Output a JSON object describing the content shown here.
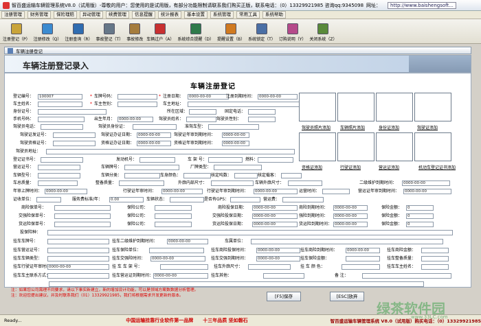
{
  "window": {
    "title": "智百盛运输车辆管理系统V8.0（试用版）-尊敬的用户：您使用的是试用版，有部分功能限制请联系我们购买正版，联系电话：（0）13329921985  咨询qq:9345098",
    "url_label": "网址：",
    "url": "http://www.baishengsoft..."
  },
  "menu": [
    "注册管理",
    "财务管理",
    "保险理赔",
    "异动管理",
    "续费管理",
    "信息提醒",
    "统计报表",
    "基本设置",
    "系统管理",
    "常用工具",
    "系统帮助"
  ],
  "toolbar": [
    {
      "label": "注册登记（P）",
      "icon": "register-icon",
      "color": "#c9a43a"
    },
    {
      "label": "注册修改（Q）",
      "icon": "edit-register-icon",
      "color": "#3b8bd0"
    },
    {
      "label": "注册查询（R）",
      "icon": "query-icon",
      "color": "#2f6cb0"
    },
    {
      "label": "事故登记（T）",
      "icon": "accident-icon",
      "color": "#667788"
    },
    {
      "label": "事故修改",
      "icon": "accident-edit-icon",
      "color": "#a57c3c"
    },
    {
      "label": "车辆过户（A）",
      "icon": "transfer-icon",
      "color": "#c83030"
    },
    {
      "label": "系统综合提醒（D）",
      "icon": "reminder-icon",
      "color": "#2f7a4a"
    },
    {
      "label": "提醒设置（B）",
      "icon": "reminder-settings-icon",
      "color": "#d07a20"
    },
    {
      "label": "系统锁定（T）",
      "icon": "lock-icon",
      "color": "#4a6fa5"
    },
    {
      "label": "订购说明（Y）",
      "icon": "order-icon",
      "color": "#b54a8a"
    },
    {
      "label": "关闭系统（Z）",
      "icon": "close-system-icon",
      "color": "#5a8a3a"
    }
  ],
  "inner_window_title": "车辆注册登记",
  "banner_title": "车辆注册登记录入",
  "form_title": "车辆注册登记",
  "fields": [
    {
      "label": "登记编号：",
      "value": "100007"
    },
    {
      "label": "车牌号码：",
      "value": ""
    },
    {
      "label": "注册日期：",
      "value": "0000-00-00"
    },
    {
      "label": "注册到期时间：",
      "value": "0000-00-00"
    },
    {
      "label": "车主姓名：",
      "value": ""
    },
    {
      "label": "车主性别：",
      "value": ""
    },
    {
      "label": "车主地址：",
      "value": ""
    },
    {
      "label": "身份证号：",
      "value": ""
    },
    {
      "label": "所在区域：",
      "value": ""
    },
    {
      "label": "固定电话：",
      "value": ""
    },
    {
      "label": "手机号码：",
      "value": ""
    },
    {
      "label": "出生年月：",
      "value": "0000-00-00"
    },
    {
      "label": "驾驶员姓名：",
      "value": ""
    },
    {
      "label": "驾驶员性别：",
      "value": ""
    },
    {
      "label": "驾驶员电话：",
      "value": ""
    },
    {
      "label": "驾驶员身份证：",
      "value": ""
    },
    {
      "label": "准驾车型：",
      "value": ""
    },
    {
      "label": "驾驶证发证号：",
      "value": ""
    },
    {
      "label": "驾驶证办证日期：",
      "value": "0000-00-00"
    },
    {
      "label": "驾驶证年审到期时间：",
      "value": "0000-00-00"
    },
    {
      "label": "驾驶资格证号：",
      "value": ""
    },
    {
      "label": "资格证办证日期：",
      "value": "0000-00-00"
    },
    {
      "label": "资格证年审到期时间：",
      "value": "0000-00-00"
    },
    {
      "label": "驾驶员地址：",
      "value": ""
    },
    {
      "label": "登记证书号：",
      "value": ""
    },
    {
      "label": "发动机号：",
      "value": ""
    },
    {
      "label": "车  架  号：",
      "value": ""
    },
    {
      "label": "燃料：",
      "value": ""
    },
    {
      "label": "营运证号：",
      "value": ""
    },
    {
      "label": "车辆牌号：",
      "value": ""
    },
    {
      "label": "厂牌类型：",
      "value": ""
    },
    {
      "label": "车辆型号：",
      "value": ""
    },
    {
      "label": "车辆分类：",
      "value": ""
    },
    {
      "label": "车身颜色：",
      "value": ""
    },
    {
      "label": "核定吨数：",
      "value": ""
    },
    {
      "label": "核定载客：",
      "value": ""
    },
    {
      "label": "车总质量：",
      "value": ""
    },
    {
      "label": "整备质量：",
      "value": ""
    },
    {
      "label": "外廓内部尺寸：",
      "value": ""
    },
    {
      "label": "车辆外廓尺寸：",
      "value": ""
    },
    {
      "label": "二级维护到期时间：",
      "value": "0000-00-00"
    },
    {
      "label": "年审上牌时间：",
      "value": "0000-00-00"
    },
    {
      "label": "行驶证年审时间：",
      "value": "0000-00-00"
    },
    {
      "label": "行驶证年审到期时间：",
      "value": "0000-00-00"
    },
    {
      "label": "运营时间：",
      "value": ""
    },
    {
      "label": "营运证年审到期时间：",
      "value": "0000-00-00"
    },
    {
      "label": "证收单位：",
      "value": ""
    },
    {
      "label": "服务费标准/年：",
      "value": "0.00"
    },
    {
      "label": "车辆状态：",
      "value": ""
    },
    {
      "label": "是否有GPS：",
      "value": ""
    },
    {
      "label": "营运费：",
      "value": ""
    },
    {
      "label": "商险保单号：",
      "value": ""
    },
    {
      "label": "保险公司：",
      "value": ""
    },
    {
      "label": "商险投保日期：",
      "value": "0000-00-00"
    },
    {
      "label": "商险到期时间：",
      "value": "0000-00-00"
    },
    {
      "label": "保险金额：",
      "value": "0"
    },
    {
      "label": "交强险保单号：",
      "value": ""
    },
    {
      "label": "保险公司：",
      "value": ""
    },
    {
      "label": "交强险投保日期：",
      "value": "0000-00-00"
    },
    {
      "label": "强险到期时间：",
      "value": "0000-00-00"
    },
    {
      "label": "保险金额：",
      "value": "0"
    },
    {
      "label": "货运险保单号：",
      "value": ""
    },
    {
      "label": "保险公司：",
      "value": ""
    },
    {
      "label": "货运险投保日期：",
      "value": "0000-00-00"
    },
    {
      "label": "货运险到期时间：",
      "value": "0000-00-00"
    },
    {
      "label": "保险金额：",
      "value": "0"
    },
    {
      "label": "投保险种：",
      "value": ""
    },
    {
      "label": "挂车车牌号：",
      "value": ""
    },
    {
      "label": "挂车二级维护到期时间：",
      "value": "0000-00-00"
    },
    {
      "label": "车属单位：",
      "value": ""
    },
    {
      "label": "挂车营运证号：",
      "value": ""
    },
    {
      "label": "挂车保险单位：",
      "value": ""
    },
    {
      "label": "挂车商险投保时间：",
      "value": "0000-00-00"
    },
    {
      "label": "挂车商险到期时间：",
      "value": "0000-00-00"
    },
    {
      "label": "挂车商险金额：",
      "value": ""
    },
    {
      "label": "挂车车辆类型：",
      "value": ""
    },
    {
      "label": "挂车交强险时间：",
      "value": "0000-00-00"
    },
    {
      "label": "挂车交强到期时间：",
      "value": "0000-00-00"
    },
    {
      "label": "挂车保险金额：",
      "value": ""
    },
    {
      "label": "挂车整备质量：",
      "value": ""
    },
    {
      "label": "挂车行驶证年审时间：",
      "value": "0000-00-00"
    },
    {
      "label": "挂 车 车 架 号：",
      "value": ""
    },
    {
      "label": "挂车外廓尺寸：",
      "value": ""
    },
    {
      "label": "挂 车 颜 色：",
      "value": ""
    },
    {
      "label": "挂车车主姓名：",
      "value": ""
    },
    {
      "label": "挂车车主联系方式：",
      "value": ""
    },
    {
      "label": "挂车营运证到期时间：",
      "value": "0000-00-00"
    },
    {
      "label": "挂车其他：",
      "value": ""
    },
    {
      "label": "备  注：",
      "value": ""
    }
  ],
  "photo_links": [
    "驾驶员照片添加",
    "车辆照片添加",
    "身份证添加",
    "驾驶证添加",
    "资格证添加",
    "行驶证添加",
    "营运证添加",
    "机动车登记证书添加"
  ],
  "notes": [
    "注：如果您公司需理不同要求，请以下事实新建立，新的增加设计功能，可以是领域方案数数据分析管理。",
    "注：欢迎您提出建议，并及时联系我们（01）13329921985，我们将根据需求开发更新的版本。"
  ],
  "buttons": {
    "save": "[F5]保存",
    "cancel": "[ESC]放弃"
  },
  "status": {
    "ready": "Ready...",
    "slogan1": "中国运输挂靠行业软件第一品牌",
    "slogan2": "十三年品质 坚如磐石",
    "product": "智百盛运输车辆管理系统 V8.0（试用版）购买电话：（0）13329921985"
  },
  "watermark": {
    "text": "绿茶软件园",
    "url": "www.33LC.com"
  }
}
